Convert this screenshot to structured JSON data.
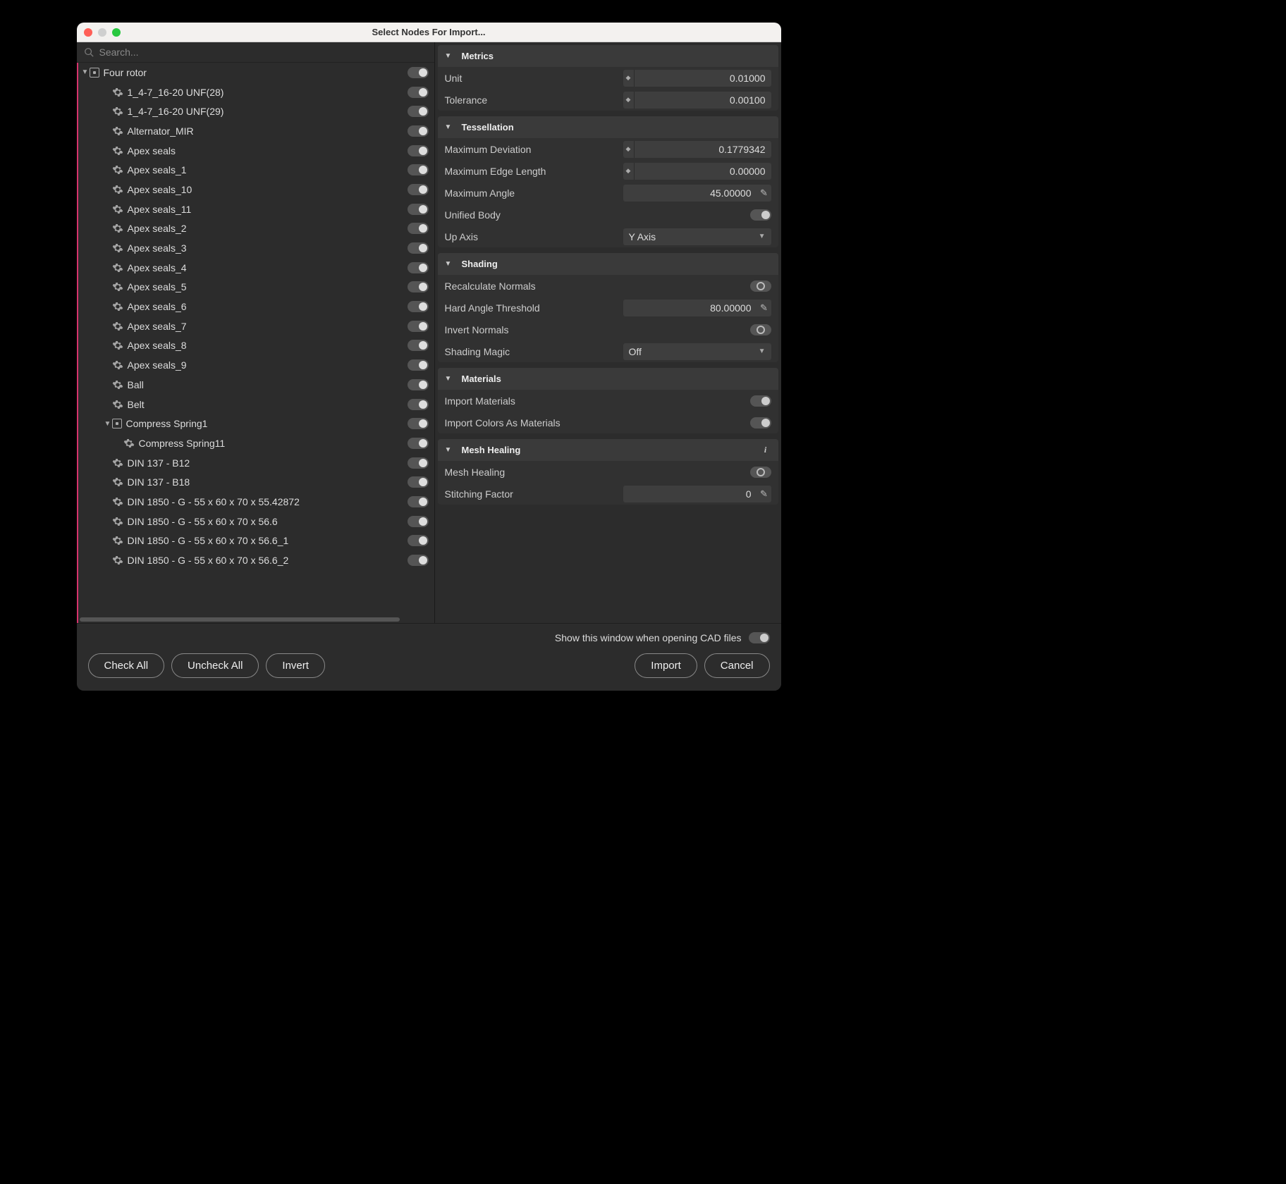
{
  "window": {
    "title": "Select Nodes For Import..."
  },
  "search": {
    "placeholder": "Search..."
  },
  "tree": {
    "root": {
      "label": "Four rotor"
    },
    "group2": {
      "label": "Compress Spring1"
    },
    "items": [
      {
        "label": "1_4-7_16-20 UNF(28)",
        "indent": 2
      },
      {
        "label": "1_4-7_16-20 UNF(29)",
        "indent": 2
      },
      {
        "label": "Alternator_MIR",
        "indent": 2
      },
      {
        "label": "Apex seals",
        "indent": 2
      },
      {
        "label": "Apex seals_1",
        "indent": 2
      },
      {
        "label": "Apex seals_10",
        "indent": 2
      },
      {
        "label": "Apex seals_11",
        "indent": 2
      },
      {
        "label": "Apex seals_2",
        "indent": 2
      },
      {
        "label": "Apex seals_3",
        "indent": 2
      },
      {
        "label": "Apex seals_4",
        "indent": 2
      },
      {
        "label": "Apex seals_5",
        "indent": 2
      },
      {
        "label": "Apex seals_6",
        "indent": 2
      },
      {
        "label": "Apex seals_7",
        "indent": 2
      },
      {
        "label": "Apex seals_8",
        "indent": 2
      },
      {
        "label": "Apex seals_9",
        "indent": 2
      },
      {
        "label": "Ball",
        "indent": 2
      },
      {
        "label": "Belt",
        "indent": 2
      },
      {
        "label": "__GROUP2__",
        "indent": 2
      },
      {
        "label": "Compress Spring11",
        "indent": 3
      },
      {
        "label": "DIN 137 - B12",
        "indent": 2
      },
      {
        "label": "DIN 137 - B18",
        "indent": 2
      },
      {
        "label": "DIN 1850 - G - 55 x 60 x 70 x 55.42872",
        "indent": 2
      },
      {
        "label": "DIN 1850 - G - 55 x 60 x 70 x 56.6",
        "indent": 2
      },
      {
        "label": "DIN 1850 - G - 55 x 60 x 70 x 56.6_1",
        "indent": 2
      },
      {
        "label": "DIN 1850 - G - 55 x 60 x 70 x 56.6_2",
        "indent": 2
      }
    ]
  },
  "sections": {
    "metrics": {
      "title": "Metrics",
      "unit_label": "Unit",
      "unit_value": "0.01000",
      "tol_label": "Tolerance",
      "tol_value": "0.00100"
    },
    "tess": {
      "title": "Tessellation",
      "maxdev_label": "Maximum Deviation",
      "maxdev_value": "0.1779342",
      "maxedge_label": "Maximum Edge Length",
      "maxedge_value": "0.00000",
      "maxangle_label": "Maximum Angle",
      "maxangle_value": "45.00000",
      "unified_label": "Unified Body",
      "upaxis_label": "Up Axis",
      "upaxis_value": "Y Axis"
    },
    "shading": {
      "title": "Shading",
      "recalc_label": "Recalculate Normals",
      "hardangle_label": "Hard Angle Threshold",
      "hardangle_value": "80.00000",
      "invert_label": "Invert Normals",
      "magic_label": "Shading Magic",
      "magic_value": "Off"
    },
    "materials": {
      "title": "Materials",
      "import_label": "Import Materials",
      "colors_label": "Import Colors As Materials"
    },
    "mesh": {
      "title": "Mesh Healing",
      "heal_label": "Mesh Healing",
      "stitch_label": "Stitching Factor",
      "stitch_value": "0"
    }
  },
  "footer": {
    "show_option": "Show this window when opening CAD files",
    "check_all": "Check All",
    "uncheck_all": "Uncheck All",
    "invert": "Invert",
    "import": "Import",
    "cancel": "Cancel"
  }
}
